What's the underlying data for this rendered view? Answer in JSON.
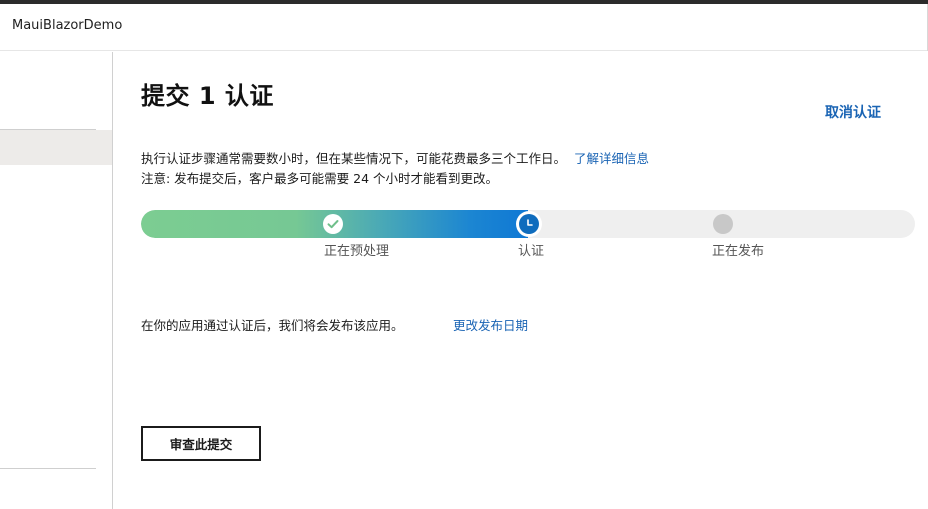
{
  "window": {
    "title": "MauiBlazorDemo"
  },
  "page": {
    "title": "提交 1 认证",
    "cancel_label": "取消认证",
    "description_line1": "执行认证步骤通常需要数小时，但在某些情况下，可能花费最多三个工作日。",
    "learn_more_label": "了解详细信息",
    "description_line2": "注意: 发布提交后，客户最多可能需要 24 个小时才能看到更改。",
    "publish_note": "在你的应用通过认证后，我们将会发布该应用。",
    "change_date_label": "更改发布日期",
    "review_button_label": "审查此提交"
  },
  "progress": {
    "completed_fraction": 0.5,
    "steps": [
      {
        "label": "正在预处理",
        "status": "done",
        "icon": "check-icon"
      },
      {
        "label": "认证",
        "status": "current",
        "icon": "clock-icon"
      },
      {
        "label": "正在发布",
        "status": "pending",
        "icon": "circle-icon"
      }
    ]
  },
  "colors": {
    "link": "#1a64b4",
    "progress_start": "#7ccd92",
    "progress_end": "#0f78d4",
    "current_step": "#0f6cbd",
    "pending_step": "#c8c8c8",
    "track": "#efefef"
  }
}
